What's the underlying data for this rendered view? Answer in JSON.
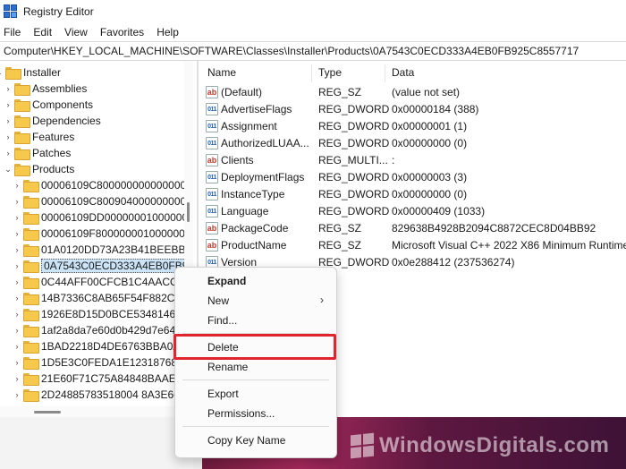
{
  "window": {
    "title": "Registry Editor"
  },
  "menu": [
    "File",
    "Edit",
    "View",
    "Favorites",
    "Help"
  ],
  "address": "Computer\\HKEY_LOCAL_MACHINE\\SOFTWARE\\Classes\\Installer\\Products\\0A7543C0ECD333A4EB0FB925C8557717",
  "tree": {
    "items": [
      {
        "label": "Installer",
        "level": 0,
        "expanded": true
      },
      {
        "label": "Assemblies",
        "level": 1
      },
      {
        "label": "Components",
        "level": 1
      },
      {
        "label": "Dependencies",
        "level": 1
      },
      {
        "label": "Features",
        "level": 1
      },
      {
        "label": "Patches",
        "level": 1
      },
      {
        "label": "Products",
        "level": 1,
        "expanded": true
      },
      {
        "label": "00006109C800000000000000000",
        "level": 2
      },
      {
        "label": "00006109C800904000000000000",
        "level": 2
      },
      {
        "label": "00006109DD000000010000000",
        "level": 2
      },
      {
        "label": "00006109F800000001000000",
        "level": 2
      },
      {
        "label": "01A0120DD73A23B41BEEBB2",
        "level": 2
      },
      {
        "label": "0A7543C0ECD333A4EB0FB92",
        "level": 2,
        "selected": true
      },
      {
        "label": "0C44AFF00CFCB1C4AACCC",
        "level": 2
      },
      {
        "label": "14B7336C8AB65F54F882CB6",
        "level": 2
      },
      {
        "label": "1926E8D15D0BCE534814666",
        "level": 2
      },
      {
        "label": "1af2a8da7e60d0b429d7e645",
        "level": 2
      },
      {
        "label": "1BAD2218D4DE6763BBA0A",
        "level": 2
      },
      {
        "label": "1D5E3C0FEDA1E123187686F",
        "level": 2
      },
      {
        "label": "21E60F71C75A84848BAAE54",
        "level": 2
      },
      {
        "label": "2D24885783518004 8A3E666F",
        "level": 2
      }
    ]
  },
  "list": {
    "columns": {
      "name": "Name",
      "type": "Type",
      "data": "Data"
    },
    "rows": [
      {
        "icon": "sz",
        "name": "(Default)",
        "type": "REG_SZ",
        "data": "(value not set)"
      },
      {
        "icon": "bin",
        "name": "AdvertiseFlags",
        "type": "REG_DWORD",
        "data": "0x00000184 (388)"
      },
      {
        "icon": "bin",
        "name": "Assignment",
        "type": "REG_DWORD",
        "data": "0x00000001 (1)"
      },
      {
        "icon": "bin",
        "name": "AuthorizedLUAA...",
        "type": "REG_DWORD",
        "data": "0x00000000 (0)"
      },
      {
        "icon": "sz",
        "name": "Clients",
        "type": "REG_MULTI...",
        "data": ":"
      },
      {
        "icon": "bin",
        "name": "DeploymentFlags",
        "type": "REG_DWORD",
        "data": "0x00000003 (3)"
      },
      {
        "icon": "bin",
        "name": "InstanceType",
        "type": "REG_DWORD",
        "data": "0x00000000 (0)"
      },
      {
        "icon": "bin",
        "name": "Language",
        "type": "REG_DWORD",
        "data": "0x00000409 (1033)"
      },
      {
        "icon": "sz",
        "name": "PackageCode",
        "type": "REG_SZ",
        "data": "829638B4928B2094C8872CEC8D04BB92"
      },
      {
        "icon": "sz",
        "name": "ProductName",
        "type": "REG_SZ",
        "data": "Microsoft Visual C++ 2022 X86 Minimum Runtime"
      },
      {
        "icon": "bin",
        "name": "Version",
        "type": "REG_DWORD",
        "data": "0x0e288412 (237536274)"
      }
    ]
  },
  "context_menu": {
    "items": [
      {
        "label": "Expand",
        "bold": true
      },
      {
        "label": "New",
        "submenu": true
      },
      {
        "label": "Find..."
      },
      {
        "separator": true
      },
      {
        "label": "Delete",
        "highlighted": true
      },
      {
        "label": "Rename"
      },
      {
        "separator": true
      },
      {
        "label": "Export"
      },
      {
        "label": "Permissions..."
      },
      {
        "separator": true
      },
      {
        "label": "Copy Key Name"
      }
    ],
    "submenu_glyph": "›"
  },
  "watermark": "WindowsDigitals.com",
  "colors": {
    "highlight_border": "#e0252f",
    "selection": "#cce4f7",
    "folder": "#f6c94c"
  }
}
